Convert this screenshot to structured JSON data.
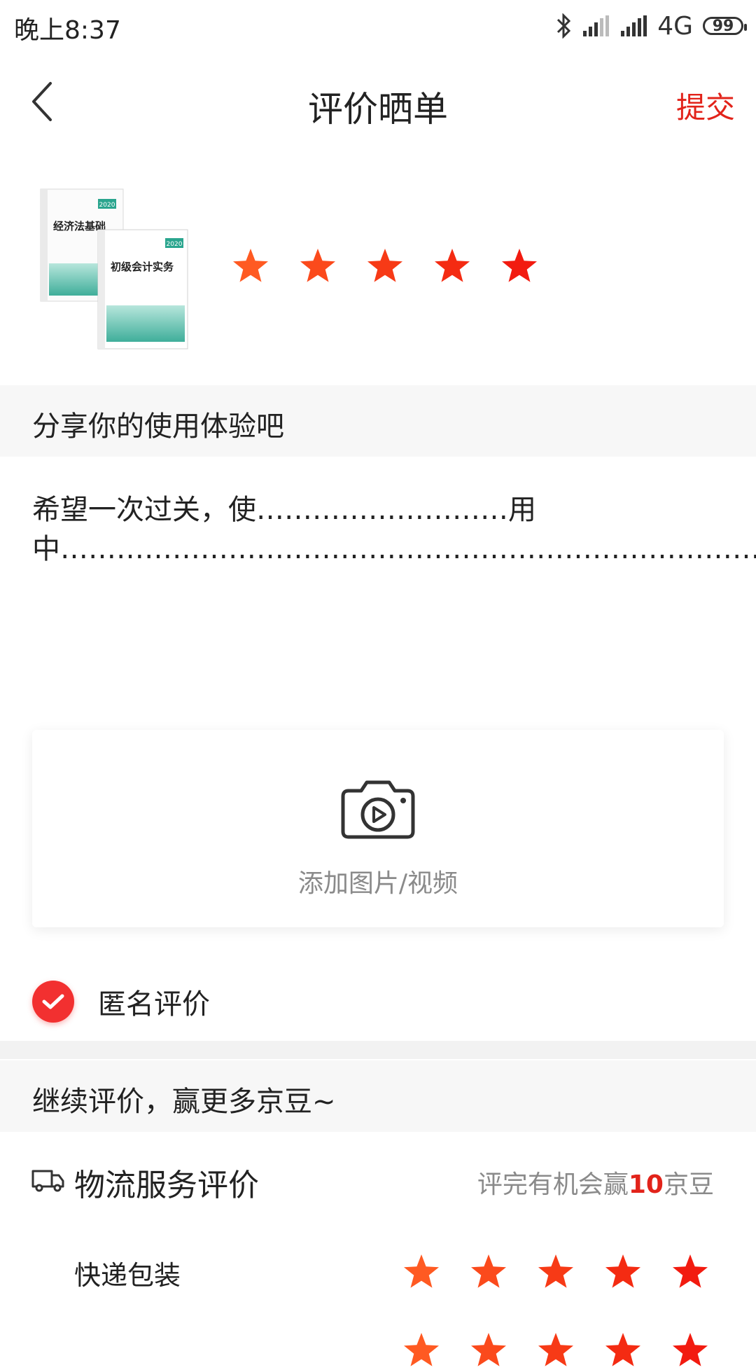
{
  "status_bar": {
    "time": "晚上8:37",
    "network": "4G",
    "battery": "99"
  },
  "nav": {
    "title": "评价晒单",
    "submit_label": "提交"
  },
  "product": {
    "image_title_top": "经济法基础",
    "image_title_front": "初级会计实务",
    "image_badge": "2020",
    "rating": 5,
    "max_rating": 5
  },
  "share_section": {
    "header": "分享你的使用体验吧",
    "review_text": "希望一次过关，使………………………用中…………………………………………………………………"
  },
  "upload": {
    "label": "添加图片/视频"
  },
  "anonymous": {
    "label": "匿名评价",
    "checked": true
  },
  "continue_section": {
    "header": "继续评价，赢更多京豆~"
  },
  "logistics": {
    "title": "物流服务评价",
    "hint_prefix": "评完有机会赢",
    "hint_number": "10",
    "hint_suffix": "京豆",
    "items": [
      {
        "label": "快递包装",
        "rating": 5
      }
    ]
  },
  "colors": {
    "accent": "#e2231a",
    "star_start": "#ff6a2b",
    "star_end": "#f21b10",
    "section_bg": "#f7f7f7"
  }
}
